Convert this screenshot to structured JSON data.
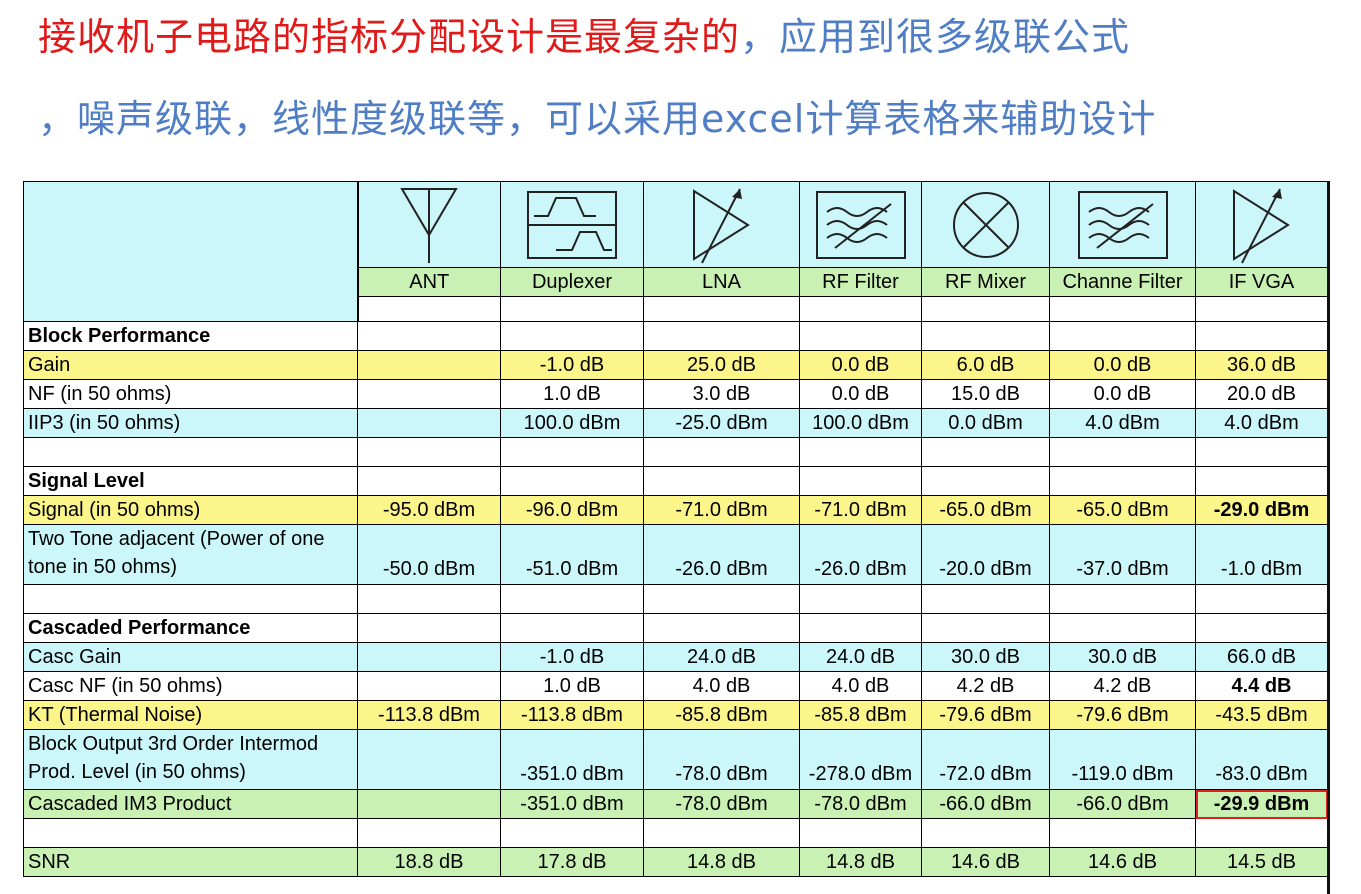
{
  "heading": {
    "line1_red": "接收机子电路的指标分配设计是最复杂的",
    "line1_blue": "，应用到很多级联公式",
    "line2": "，噪声级联，线性度级联等，可以采用excel计算表格来辅助设计"
  },
  "stages": [
    {
      "name": "ANT",
      "icon": "antenna-icon"
    },
    {
      "name": "Duplexer",
      "icon": "duplexer-icon"
    },
    {
      "name": "LNA",
      "icon": "lna-amplifier-icon"
    },
    {
      "name": "RF Filter",
      "icon": "rf-filter-icon"
    },
    {
      "name": "RF Mixer",
      "icon": "mixer-icon"
    },
    {
      "name": "Channe Filter",
      "icon": "channel-filter-icon"
    },
    {
      "name": "IF VGA",
      "icon": "vga-amplifier-icon"
    }
  ],
  "sections": {
    "block": "Block Performance",
    "signal": "Signal Level",
    "cascaded": "Cascaded Performance"
  },
  "rows": {
    "gain": {
      "label": "Gain",
      "values": [
        "",
        "-1.0 dB",
        "25.0 dB",
        "0.0 dB",
        "6.0 dB",
        "0.0 dB",
        "36.0 dB"
      ]
    },
    "nf": {
      "label": "NF (in 50 ohms)",
      "values": [
        "",
        "1.0 dB",
        "3.0 dB",
        "0.0 dB",
        "15.0 dB",
        "0.0 dB",
        "20.0 dB"
      ]
    },
    "iip3": {
      "label": "IIP3 (in 50 ohms)",
      "values": [
        "",
        "100.0 dBm",
        "-25.0 dBm",
        "100.0 dBm",
        "0.0 dBm",
        "4.0 dBm",
        "4.0 dBm"
      ]
    },
    "signal": {
      "label": "Signal (in 50 ohms)",
      "values": [
        "-95.0 dBm",
        "-96.0 dBm",
        "-71.0 dBm",
        "-71.0 dBm",
        "-65.0 dBm",
        "-65.0 dBm",
        "-29.0 dBm"
      ]
    },
    "two_tone": {
      "label": "Two Tone adjacent (Power of one tone in 50 ohms)",
      "values": [
        "-50.0 dBm",
        "-51.0 dBm",
        "-26.0 dBm",
        "-26.0 dBm",
        "-20.0 dBm",
        "-37.0 dBm",
        "-1.0 dBm"
      ]
    },
    "casc_gain": {
      "label": "Casc Gain",
      "values": [
        "",
        "-1.0 dB",
        "24.0 dB",
        "24.0 dB",
        "30.0 dB",
        "30.0 dB",
        "66.0 dB"
      ]
    },
    "casc_nf": {
      "label": "Casc NF (in 50 ohms)",
      "values": [
        "",
        "1.0 dB",
        "4.0 dB",
        "4.0 dB",
        "4.2 dB",
        "4.2 dB",
        "4.4 dB"
      ]
    },
    "kt": {
      "label": "KT (Thermal Noise)",
      "values": [
        "-113.8 dBm",
        "-113.8 dBm",
        "-85.8 dBm",
        "-85.8 dBm",
        "-79.6 dBm",
        "-79.6 dBm",
        "-43.5 dBm"
      ]
    },
    "block_im3": {
      "label": "Block Output 3rd Order Intermod Prod. Level (in 50 ohms)",
      "values": [
        "",
        "-351.0 dBm",
        "-78.0 dBm",
        "-278.0 dBm",
        "-72.0 dBm",
        "-119.0 dBm",
        "-83.0 dBm"
      ]
    },
    "casc_im3": {
      "label": "Cascaded IM3 Product",
      "values": [
        "",
        "-351.0 dBm",
        "-78.0 dBm",
        "-78.0 dBm",
        "-66.0 dBm",
        "-66.0 dBm",
        "-29.9 dBm"
      ]
    },
    "snr": {
      "label": "SNR",
      "values": [
        "18.8 dB",
        "17.8 dB",
        "14.8 dB",
        "14.8 dB",
        "14.6 dB",
        "14.6 dB",
        "14.5 dB"
      ]
    }
  }
}
